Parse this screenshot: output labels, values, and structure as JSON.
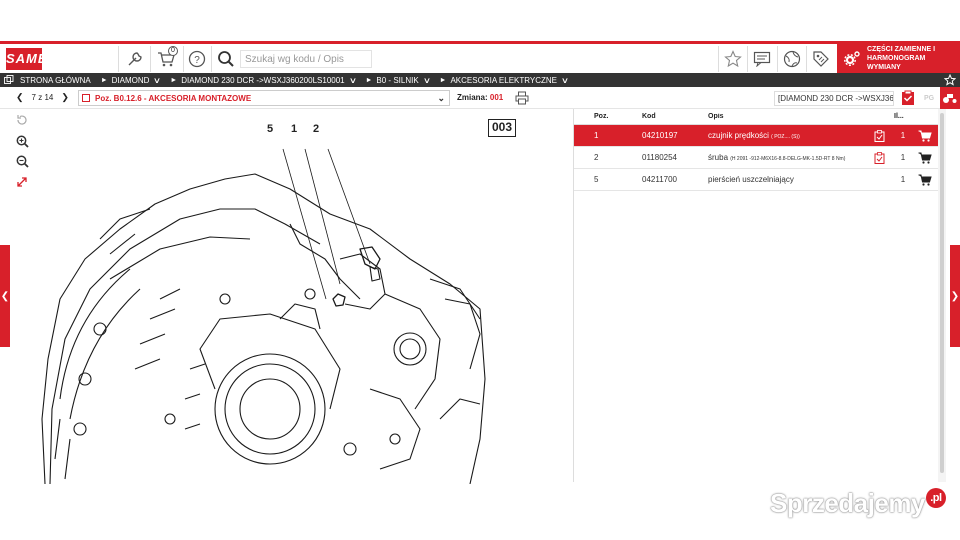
{
  "brand": {
    "logo_text": "SAME",
    "accent": "#d8202a"
  },
  "header": {
    "cart_count": "0",
    "search_placeholder": "Szukaj wg kodu / Opis",
    "parts_button_label": "CZĘŚCI ZAMIENNE I HARMONOGRAM WYMIANY"
  },
  "breadcrumbs": [
    {
      "label": "STRONA GŁÓWNA"
    },
    {
      "label": "DIAMOND"
    },
    {
      "label": "DIAMOND 230 DCR ->WSXJ360200LS10001"
    },
    {
      "label": "B0 - SILNIK"
    },
    {
      "label": "AKCESORIA ELEKTRYCZNE"
    }
  ],
  "toolbar": {
    "page_indicator": "7 z 14",
    "section_title": "Poz. B0.12.6 - AKCESORIA MONTAZOWE",
    "zmiana_label": "Zmiana:",
    "zmiana_value": "001",
    "model_label": "[DIAMOND 230 DCR ->WSXJ360..."
  },
  "drawing": {
    "sheet_number": "003",
    "callouts": [
      "5",
      "1",
      "2"
    ]
  },
  "parts_table": {
    "headers": {
      "poz": "Poz.",
      "kod": "Kod",
      "opis": "Opis",
      "ilosc": "Il..."
    },
    "rows": [
      {
        "poz": "1",
        "kod": "04210197",
        "opis": "czujnik prędkości",
        "opis_detail": "( POZ.... (S))",
        "qty": "1",
        "selected": true
      },
      {
        "poz": "2",
        "kod": "01180254",
        "opis": "śruba",
        "opis_detail": "(H 2091 -912-M6X16-8.8-DELG-MK-1.5D-RT 8 Nm)",
        "qty": "1",
        "selected": false
      },
      {
        "poz": "5",
        "kod": "04211700",
        "opis": "pierścień uszczelniający",
        "opis_detail": "",
        "qty": "1",
        "selected": false
      }
    ]
  },
  "watermark": {
    "text": "Sprzedajemy",
    "badge": ".pl"
  }
}
